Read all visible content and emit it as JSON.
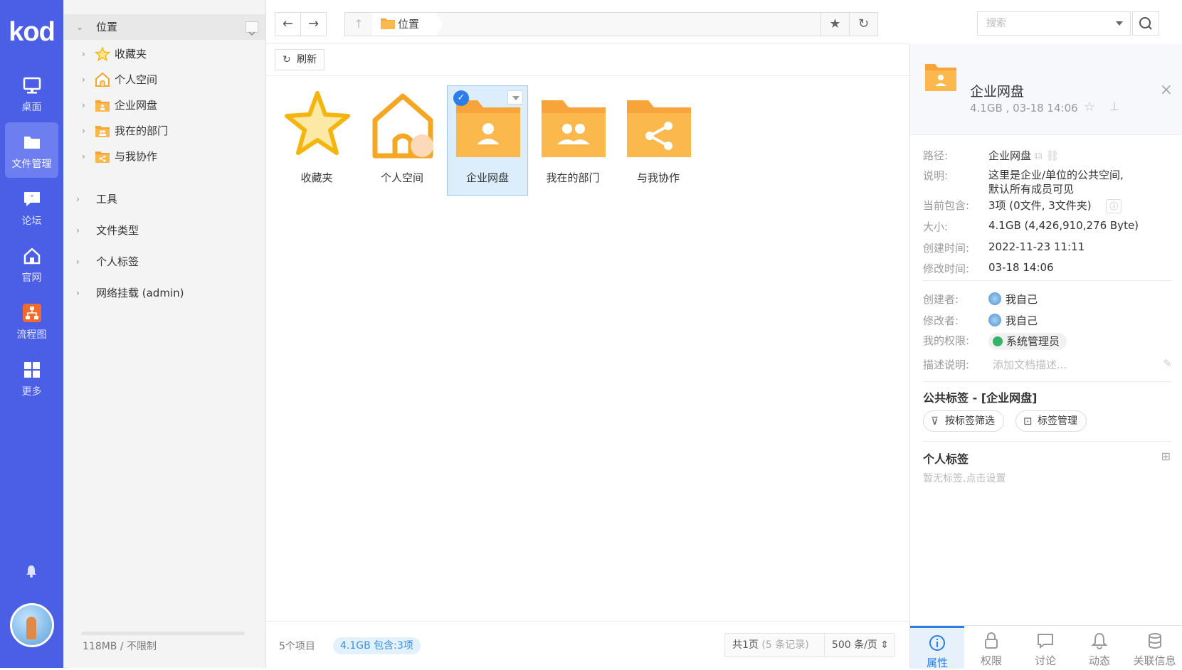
{
  "app": {
    "logo_text": "kod",
    "accent_color": "#4b5fe6"
  },
  "rail": {
    "items": [
      {
        "label": "桌面",
        "icon": "monitor-icon"
      },
      {
        "label": "文件管理",
        "icon": "folder-icon",
        "active": true
      },
      {
        "label": "论坛",
        "icon": "forum-icon"
      },
      {
        "label": "官网",
        "icon": "home-icon"
      },
      {
        "label": "流程图",
        "icon": "flowchart-icon"
      },
      {
        "label": "更多",
        "icon": "grid-icon"
      }
    ],
    "bell_icon": "bell-icon"
  },
  "tree": {
    "root": "位置",
    "children": [
      "收藏夹",
      "个人空间",
      "企业网盘",
      "我在的部门",
      "与我协作"
    ],
    "sections": [
      "工具",
      "文件类型",
      "个人标签",
      "网络挂载 (admin)"
    ],
    "quota": "118MB / 不限制"
  },
  "toolbar": {
    "breadcrumb": "位置",
    "refresh_label": "刷新",
    "search_placeholder": "搜索"
  },
  "files": [
    {
      "name": "收藏夹",
      "icon": "star-icon"
    },
    {
      "name": "个人空间",
      "icon": "home-icon"
    },
    {
      "name": "企业网盘",
      "icon": "company-folder-icon",
      "selected": true
    },
    {
      "name": "我在的部门",
      "icon": "department-folder-icon"
    },
    {
      "name": "与我协作",
      "icon": "share-folder-icon"
    }
  ],
  "status": {
    "item_count": "5个项目",
    "selection": "4.1GB 包含:3项",
    "pages": "共1页",
    "records": "(5 条记录)",
    "page_size": "500 条/页"
  },
  "detail": {
    "name": "企业网盘",
    "meta": "4.1GB , 03-18 14:06",
    "path_label": "路径:",
    "path": "企业网盘",
    "desc_label": "说明:",
    "desc_line1": "这里是企业/单位的公共空间,",
    "desc_line2": "默认所有成员可见",
    "contains_label": "当前包含:",
    "contains": "3项 (0文件, 3文件夹)",
    "size_label": "大小:",
    "size": "4.1GB (4,426,910,276 Byte)",
    "created_label": "创建时间:",
    "created": "2022-11-23 11:11",
    "modified_label": "修改时间:",
    "modified": "03-18 14:06",
    "creator_label": "创建者:",
    "creator": "我自己",
    "modifier_label": "修改者:",
    "modifier": "我自己",
    "perm_label": "我的权限:",
    "perm": "系统管理员",
    "note_label": "描述说明:",
    "note_placeholder": "添加文档描述...",
    "public_tags_title": "公共标签 - [企业网盘]",
    "filter_by_tag": "按标签筛选",
    "manage_tags": "标签管理",
    "personal_tags_title": "个人标签",
    "personal_tags_empty": "暂无标签,点击设置",
    "tabs": [
      "属性",
      "权限",
      "讨论",
      "动态",
      "关联信息"
    ]
  }
}
